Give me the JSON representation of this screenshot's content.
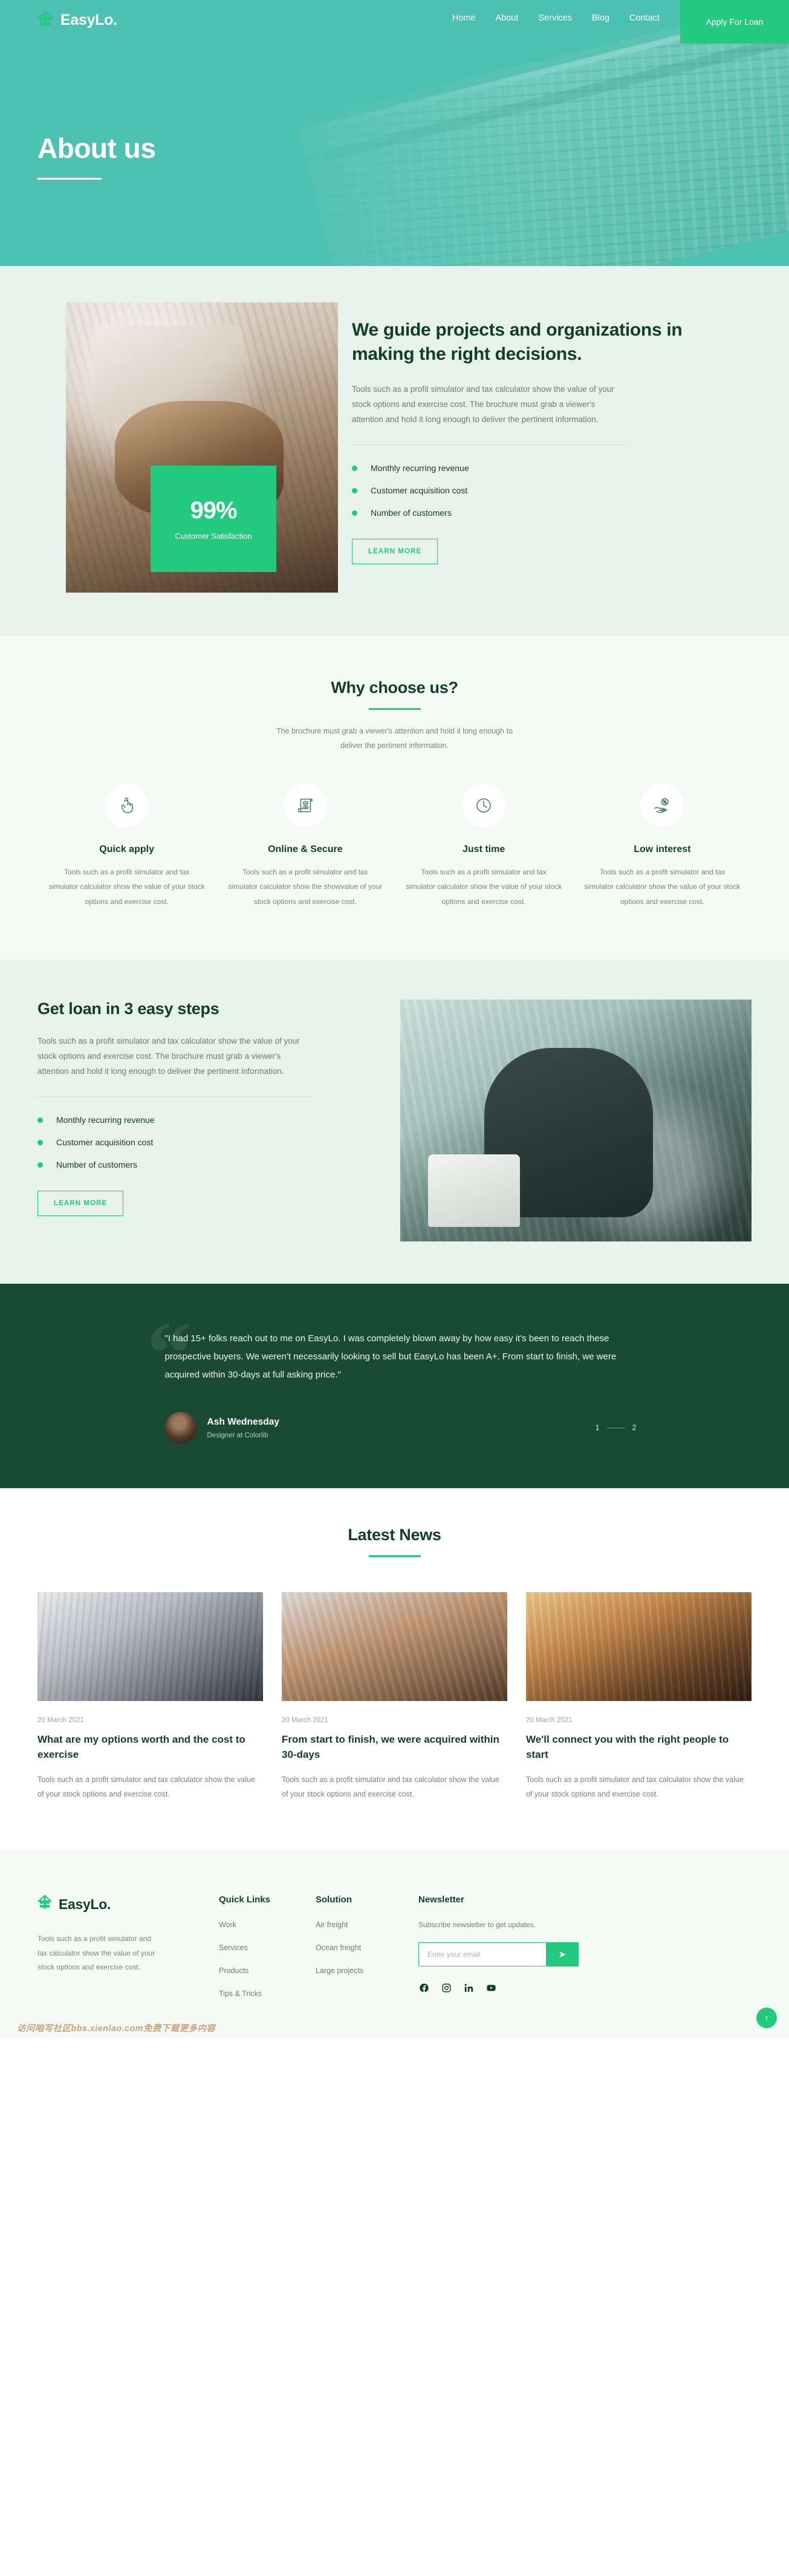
{
  "header": {
    "brand": "EasyLo.",
    "brand_icon": "house-icon",
    "nav": [
      {
        "label": "Home"
      },
      {
        "label": "About"
      },
      {
        "label": "Services"
      },
      {
        "label": "Blog"
      },
      {
        "label": "Contact"
      }
    ],
    "cta_label": "Apply For Loan",
    "accent": "#22c97e"
  },
  "hero": {
    "title": "About us"
  },
  "guide": {
    "heading": "We guide projects and organizations in making the right decisions.",
    "paragraph": "Tools such as a profit simulator and tax calculator show the value of your stock options and exercise cost. The brochure must grab a viewer's attention and hold it long enough to deliver the pertinent information.",
    "bullets": [
      {
        "label": "Monthly recurring revenue"
      },
      {
        "label": "Customer acquisition cost"
      },
      {
        "label": "Number of customers"
      }
    ],
    "button_label": "LEARN MORE",
    "badge_number": "99%",
    "badge_label": "Customer Satisfaction"
  },
  "why": {
    "title": "Why choose us?",
    "subtitle": "The brochure must grab a viewer's attention and hold it long enough to deliver the pertinent information.",
    "features": [
      {
        "icon": "hand-pointer-icon",
        "title": "Quick apply",
        "text": "Tools such as a profit simulator and tax simulator calculator show the value of your stock options and exercise cost."
      },
      {
        "icon": "document-shield-icon",
        "title": "Online & Secure",
        "text": "Tools such as a profit simulator and tax simulator calculator show the showvalue of your stock options and exercise cost."
      },
      {
        "icon": "clock-icon",
        "title": "Just time",
        "text": "Tools such as a profit simulator and tax simulator calculator show the value of your stock options and exercise cost."
      },
      {
        "icon": "hand-coin-icon",
        "title": "Low interest",
        "text": "Tools such as a profit simulator and tax simulator calculator show the value of your stock options and exercise cost."
      }
    ]
  },
  "steps": {
    "heading": "Get loan in 3 easy steps",
    "paragraph": "Tools such as a profit simulator and tax calculator show the value of your stock options and exercise cost. The brochure must grab a viewer's attention and hold it long enough to deliver the pertinent information.",
    "bullets": [
      {
        "label": "Monthly recurring revenue"
      },
      {
        "label": "Customer acquisition cost"
      },
      {
        "label": "Number of customers"
      }
    ],
    "button_label": "LEARN MORE"
  },
  "testimonial": {
    "quote": "\"I had 15+ folks reach out to me on EasyLo. I was completely blown away by how easy it's been to reach these prospective buyers. We weren't necessarily looking to sell but EasyLo has been A+. From start to finish, we were acquired within 30-days at full asking price.\"",
    "name": "Ash Wednesday",
    "role": "Designer at Colorlib",
    "pager": {
      "current": "1",
      "next": "2"
    },
    "background": "#1a4a33"
  },
  "news": {
    "title": "Latest News",
    "cards": [
      {
        "date": "20 March 2021",
        "title": "What are my options worth and the cost to exercise",
        "text": "Tools such as a profit simulator and tax calculator show the value of your stock options and exercise cost."
      },
      {
        "date": "20 March 2021",
        "title": "From start to finish, we were acquired within 30-days",
        "text": "Tools such as a profit simulator and tax calculator show the value of your stock options and exercise cost."
      },
      {
        "date": "20 March 2021",
        "title": "We'll connect you with the right people to start",
        "text": "Tools such as a profit simulator and tax calculator show the value of your stock options and exercise cost."
      }
    ]
  },
  "footer": {
    "brand": "EasyLo.",
    "description": "Tools such as a profit simulator and tax calculator show the value of your stock options and exercise cost.",
    "quick_links": {
      "title": "Quick Links",
      "items": [
        {
          "label": "Work"
        },
        {
          "label": "Services"
        },
        {
          "label": "Products"
        },
        {
          "label": "Tips & Tricks"
        }
      ]
    },
    "solution": {
      "title": "Solution",
      "items": [
        {
          "label": "Air freight"
        },
        {
          "label": "Ocean freight"
        },
        {
          "label": "Large projects"
        }
      ]
    },
    "newsletter": {
      "title": "Newsletter",
      "description": "Subscribe newsletter to get updates.",
      "placeholder": "Enter your email",
      "value": "",
      "submit_icon": "send-arrow-icon"
    },
    "socials": [
      {
        "icon": "facebook-icon"
      },
      {
        "icon": "instagram-icon"
      },
      {
        "icon": "linkedin-icon"
      },
      {
        "icon": "youtube-icon"
      }
    ],
    "back_to_top_icon": "arrow-up-icon",
    "watermark": "访问咱写社区bbs.xienlao.com免费下载更多内容"
  }
}
